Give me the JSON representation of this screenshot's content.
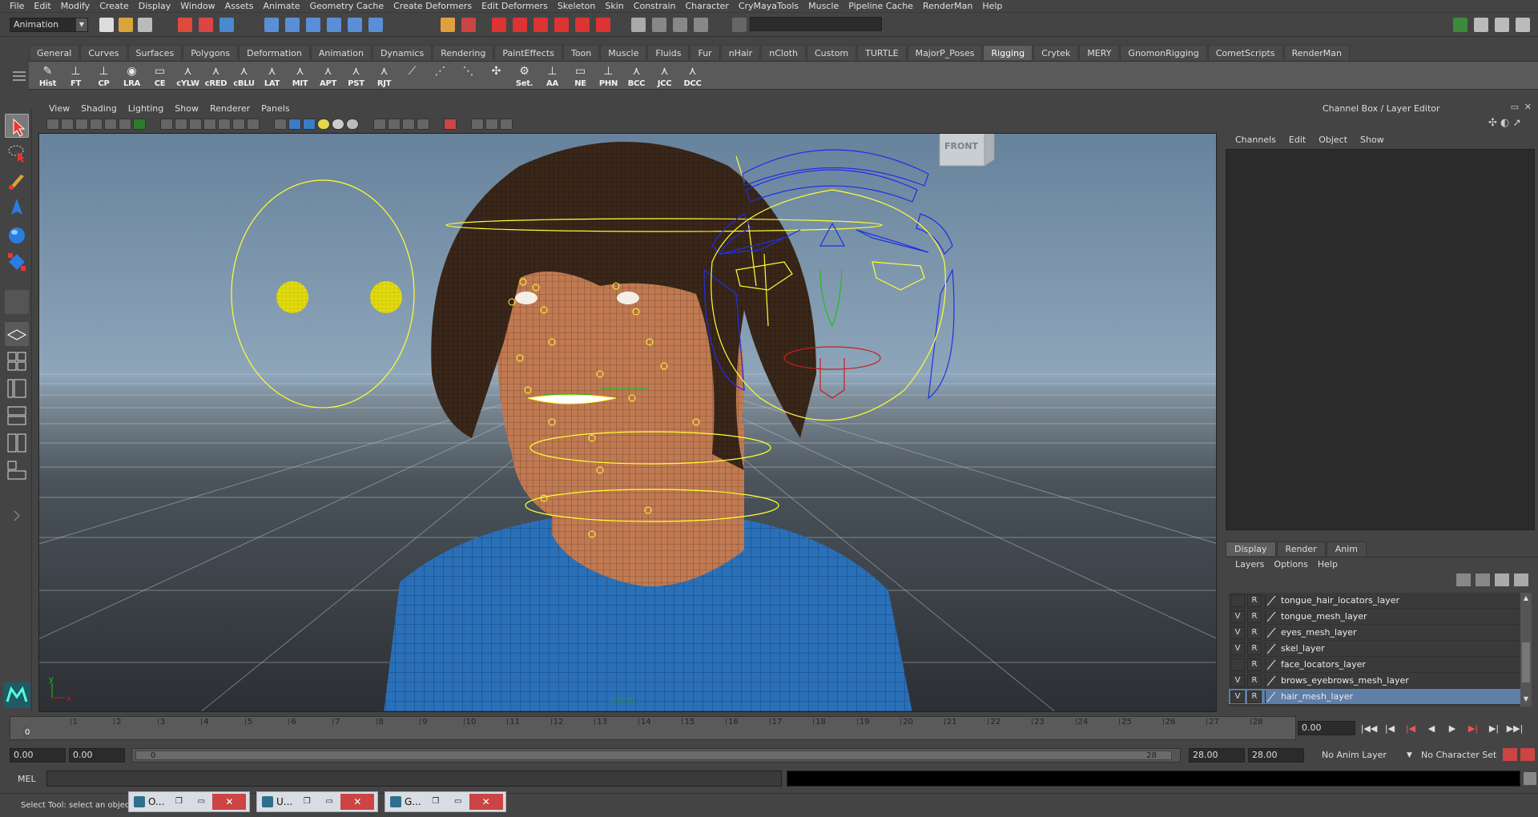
{
  "menubar": [
    "File",
    "Edit",
    "Modify",
    "Create",
    "Display",
    "Window",
    "Assets",
    "Animate",
    "Geometry Cache",
    "Create Deformers",
    "Edit Deformers",
    "Skeleton",
    "Skin",
    "Constrain",
    "Character",
    "CryMayaTools",
    "Muscle",
    "Pipeline Cache",
    "RenderMan",
    "Help"
  ],
  "status_line": {
    "mode": "Animation"
  },
  "shelf": {
    "tabs": [
      "General",
      "Curves",
      "Surfaces",
      "Polygons",
      "Deformation",
      "Animation",
      "Dynamics",
      "Rendering",
      "PaintEffects",
      "Toon",
      "Muscle",
      "Fluids",
      "Fur",
      "nHair",
      "nCloth",
      "Custom",
      "TURTLE",
      "MajorP_Poses",
      "Rigging",
      "Crytek",
      "MERY",
      "GnomonRigging",
      "CometScripts",
      "RenderMan"
    ],
    "active_tab": "Rigging",
    "buttons": [
      {
        "label": "Hist",
        "icon": "history-icon"
      },
      {
        "label": "FT",
        "icon": "freeze-transform-icon"
      },
      {
        "label": "CP",
        "icon": "center-pivot-icon"
      },
      {
        "label": "LRA",
        "icon": "local-rotation-axis-icon"
      },
      {
        "label": "CE",
        "icon": "create-empty-icon"
      },
      {
        "label": "cYLW",
        "icon": "color-yellow-icon"
      },
      {
        "label": "cRED",
        "icon": "color-red-icon"
      },
      {
        "label": "cBLU",
        "icon": "color-blue-icon"
      },
      {
        "label": "LAT",
        "icon": "lattice-icon"
      },
      {
        "label": "MIT",
        "icon": "mit-icon"
      },
      {
        "label": "APT",
        "icon": "apt-icon"
      },
      {
        "label": "PST",
        "icon": "pst-icon"
      },
      {
        "label": "RJT",
        "icon": "rjt-icon"
      },
      {
        "label": "",
        "icon": "joint-chain-icon"
      },
      {
        "label": "",
        "icon": "joint-tool-icon"
      },
      {
        "label": "",
        "icon": "ik-handle-icon"
      },
      {
        "label": "",
        "icon": "ik-spline-icon"
      },
      {
        "label": "Set.",
        "icon": "set-icon"
      },
      {
        "label": "AA",
        "icon": "aa-icon"
      },
      {
        "label": "NE",
        "icon": "node-editor-icon"
      },
      {
        "label": "PHN",
        "icon": "phn-icon"
      },
      {
        "label": "BCC",
        "icon": "bcc-icon"
      },
      {
        "label": "JCC",
        "icon": "jcc-icon"
      },
      {
        "label": "DCC",
        "icon": "dcc-icon"
      }
    ]
  },
  "viewport": {
    "menu": [
      "View",
      "Shading",
      "Lighting",
      "Show",
      "Renderer",
      "Panels"
    ],
    "camera_label": "persp",
    "view_cube_label": "FRONT",
    "axis_x": "x",
    "axis_y": "y"
  },
  "channel_box": {
    "title": "Channel Box / Layer Editor",
    "menu": [
      "Channels",
      "Edit",
      "Object",
      "Show"
    ]
  },
  "layer_editor": {
    "tabs": [
      "Display",
      "Render",
      "Anim"
    ],
    "active_tab": "Display",
    "menu": [
      "Layers",
      "Options",
      "Help"
    ],
    "layers": [
      {
        "v": "",
        "r": "R",
        "name": "tongue_hair_locators_layer",
        "selected": false
      },
      {
        "v": "V",
        "r": "R",
        "name": "tongue_mesh_layer",
        "selected": false
      },
      {
        "v": "V",
        "r": "R",
        "name": "eyes_mesh_layer",
        "selected": false
      },
      {
        "v": "V",
        "r": "R",
        "name": "skel_layer",
        "selected": false
      },
      {
        "v": "",
        "r": "R",
        "name": "face_locators_layer",
        "selected": false
      },
      {
        "v": "V",
        "r": "R",
        "name": "brows_eyebrows_mesh_layer",
        "selected": false
      },
      {
        "v": "V",
        "r": "R",
        "name": "hair_mesh_layer",
        "selected": true
      }
    ]
  },
  "time_slider": {
    "ticks": [
      "1",
      "2",
      "3",
      "4",
      "5",
      "6",
      "7",
      "8",
      "9",
      "10",
      "11",
      "12",
      "13",
      "14",
      "15",
      "16",
      "17",
      "18",
      "19",
      "20",
      "21",
      "22",
      "23",
      "24",
      "25",
      "26",
      "27",
      "28"
    ],
    "current": "0",
    "current_time": "0.00"
  },
  "range_slider": {
    "start_time": "0.00",
    "playback_start": "0.00",
    "range_start": "0",
    "range_end": "28",
    "playback_end": "28.00",
    "end_time": "28.00",
    "anim_layer": "No Anim Layer",
    "character_set": "No Character Set"
  },
  "command_line": {
    "label": "MEL"
  },
  "help_line": {
    "text": "Select Tool: select an object"
  },
  "taskbar_windows": [
    {
      "title": "O..."
    },
    {
      "title": "U..."
    },
    {
      "title": "G..."
    }
  ],
  "colors": {
    "rig_yellow": "#ffff33",
    "rig_blue": "#1f2fe6",
    "rig_red": "#cc1d1d",
    "rig_green": "#22bb22",
    "skin": "#c07a52",
    "hair": "#3a271a",
    "shirt": "#2a70b8",
    "selection": "#5e7fa8"
  }
}
